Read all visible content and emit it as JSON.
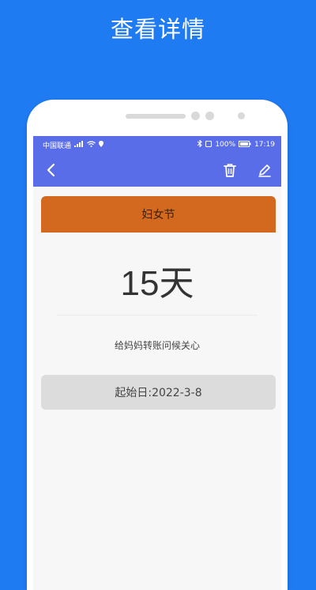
{
  "promo": {
    "title": "查看详情"
  },
  "status_bar": {
    "carrier": "中国联通",
    "battery": "100%",
    "time": "17:19"
  },
  "header": {
    "back_icon": "chevron-left-icon",
    "delete_icon": "trash-icon",
    "edit_icon": "pencil-icon"
  },
  "event": {
    "name": "妇女节",
    "days": "15天",
    "note": "给妈妈转账问候关心",
    "start_date": "起始日:2022-3-8"
  },
  "colors": {
    "background": "#1f7bf2",
    "app_bar": "#5a6de8",
    "event_banner": "#d2691e",
    "date_bar": "#dcdcdc"
  }
}
